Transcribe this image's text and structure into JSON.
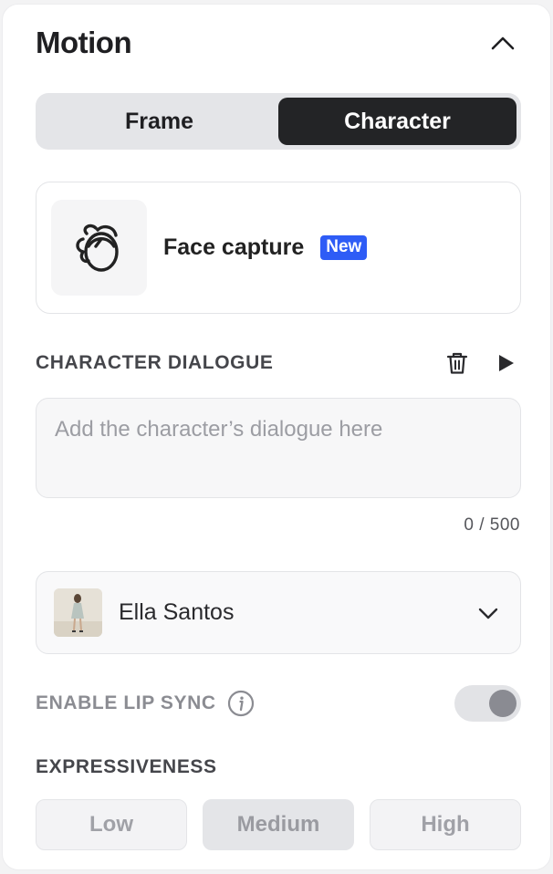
{
  "header": {
    "title": "Motion",
    "collapse_icon": "chevron-up-icon"
  },
  "mode_tabs": [
    {
      "label": "Frame",
      "active": false
    },
    {
      "label": "Character",
      "active": true
    }
  ],
  "face_capture": {
    "label": "Face capture",
    "badge": "New",
    "icon": "face-capture-icon",
    "badge_color": "#2e5cf6"
  },
  "dialogue": {
    "section_label": "CHARACTER DIALOGUE",
    "placeholder": "Add the character’s dialogue here",
    "value": "",
    "counter": "0 / 500",
    "delete_icon": "trash-icon",
    "play_icon": "play-icon"
  },
  "voice": {
    "name": "Ella Santos",
    "dropdown_icon": "chevron-down-icon"
  },
  "lip_sync": {
    "label": "ENABLE LIP SYNC",
    "info_icon": "info-icon",
    "enabled": true
  },
  "expressiveness": {
    "label": "EXPRESSIVENESS",
    "options": [
      "Low",
      "Medium",
      "High"
    ],
    "selected": "Medium"
  },
  "colors": {
    "accent": "#2e5cf6",
    "active_tab": "#232426"
  }
}
